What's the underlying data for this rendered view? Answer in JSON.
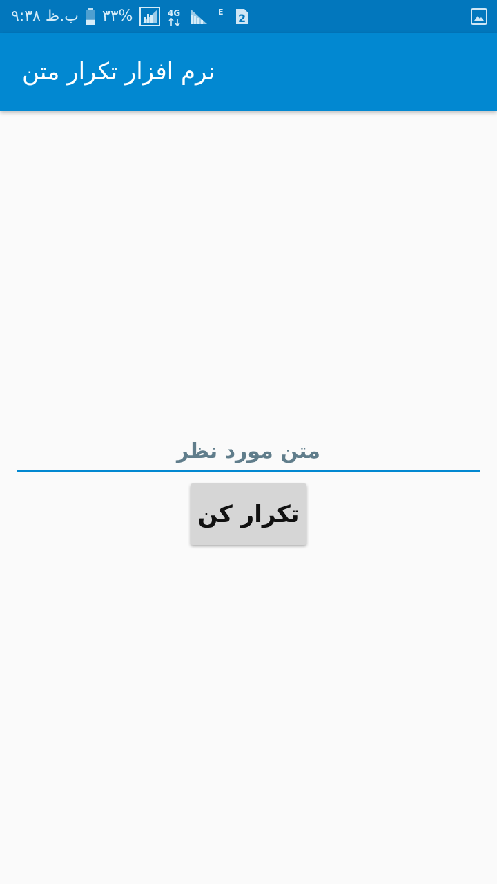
{
  "status_bar": {
    "time": "۹:۳۸ ب.ظ",
    "battery_percent": "۳۳%",
    "battery_level": 0.33,
    "network_4g": "4G",
    "network_e": "E",
    "sim_badge": "2",
    "icons": [
      "battery-icon",
      "signal-icon",
      "network-4g-icon",
      "signal-icon",
      "network-e-icon",
      "sim-icon",
      "gallery-icon"
    ]
  },
  "app_bar": {
    "title": "نرم افزار تکرار متن"
  },
  "form": {
    "input_placeholder": "متن مورد نظر",
    "input_value": "",
    "button_label": "تکرار کن"
  },
  "colors": {
    "status_bar": "#0277bd",
    "app_bar": "#0288d1",
    "background": "#fafafa",
    "accent": "#0288d1",
    "button": "#d6d6d6"
  }
}
